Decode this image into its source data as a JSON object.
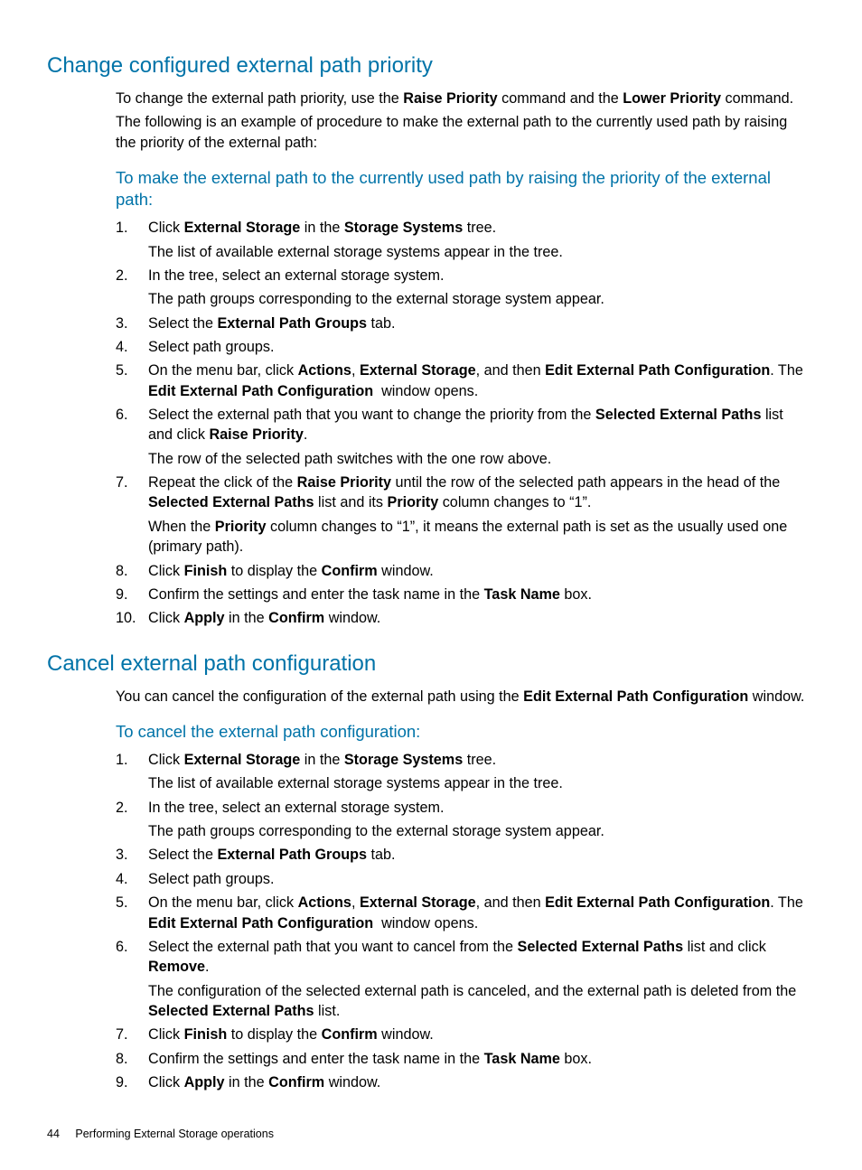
{
  "section1": {
    "title": "Change configured external path priority",
    "intro1_html": "To change the external path priority, use the <b>Raise Priority</b> command and the <b>Lower Priority</b> command.",
    "intro2": "The following is an example of procedure to make the external path to the currently used path by raising the priority of the external path:",
    "subhead": "To make the external path to the currently used path by raising the priority of the external path:",
    "steps": [
      {
        "n": "1.",
        "html": "Click <b>External Storage</b> in the <b>Storage Systems</b> tree.",
        "sub": "The list of available external storage systems appear in the tree."
      },
      {
        "n": "2.",
        "html": "In the tree, select an external storage system.",
        "sub": "The path groups corresponding to the external storage system appear."
      },
      {
        "n": "3.",
        "html": "Select the <b>External Path Groups</b> tab."
      },
      {
        "n": "4.",
        "html": "Select path groups."
      },
      {
        "n": "5.",
        "html": "On the menu bar, click <b>Actions</b>, <b>External Storage</b>, and then <b>Edit External Path Configuration</b>. The <b>Edit External Path Configuration</b>&nbsp; window opens."
      },
      {
        "n": "6.",
        "html": "Select the external path that you want to change the priority from the <b>Selected External Paths</b> list and click <b>Raise Priority</b>.",
        "sub": "The row of the selected path switches with the one row above."
      },
      {
        "n": "7.",
        "html": "Repeat the click of the <b>Raise Priority</b> until the row of the selected path appears in the head of the <b>Selected External Paths</b> list and its <b>Priority</b> column changes to “1”.",
        "sub_html": "When the <b>Priority</b> column changes to “1”, it means the external path is set as the usually used one (primary path)."
      },
      {
        "n": "8.",
        "html": "Click <b>Finish</b> to display the <b>Confirm</b> window."
      },
      {
        "n": "9.",
        "html": "Confirm the settings and enter the task name in the <b>Task Name</b> box."
      },
      {
        "n": "10.",
        "html": "Click <b>Apply</b> in the <b>Confirm</b> window."
      }
    ]
  },
  "section2": {
    "title": "Cancel external path configuration",
    "intro_html": "You can cancel the configuration of the external path using the <b>Edit External Path Configuration</b> window.",
    "subhead": "To cancel the external path configuration:",
    "steps": [
      {
        "n": "1.",
        "html": "Click <b>External Storage</b> in the <b>Storage Systems</b> tree.",
        "sub": "The list of available external storage systems appear in the tree."
      },
      {
        "n": "2.",
        "html": "In the tree, select an external storage system.",
        "sub": "The path groups corresponding to the external storage system appear."
      },
      {
        "n": "3.",
        "html": "Select the <b>External Path Groups</b> tab."
      },
      {
        "n": "4.",
        "html": "Select path groups."
      },
      {
        "n": "5.",
        "html": "On the menu bar, click <b>Actions</b>, <b>External Storage</b>, and then <b>Edit External Path Configuration</b>. The <b>Edit External Path Configuration</b>&nbsp; window opens."
      },
      {
        "n": "6.",
        "html": "Select the external path that you want to cancel from the <b>Selected External Paths</b> list and click <b>Remove</b>.",
        "sub_html": "The configuration of the selected external path is canceled, and the external path is deleted from the <b>Selected External Paths</b> list."
      },
      {
        "n": "7.",
        "html": "Click <b>Finish</b> to display the <b>Confirm</b> window."
      },
      {
        "n": "8.",
        "html": "Confirm the settings and enter the task name in the <b>Task Name</b> box."
      },
      {
        "n": "9.",
        "html": "Click <b>Apply</b> in the <b>Confirm</b> window."
      }
    ]
  },
  "footer": {
    "page": "44",
    "chapter": "Performing External Storage operations"
  }
}
